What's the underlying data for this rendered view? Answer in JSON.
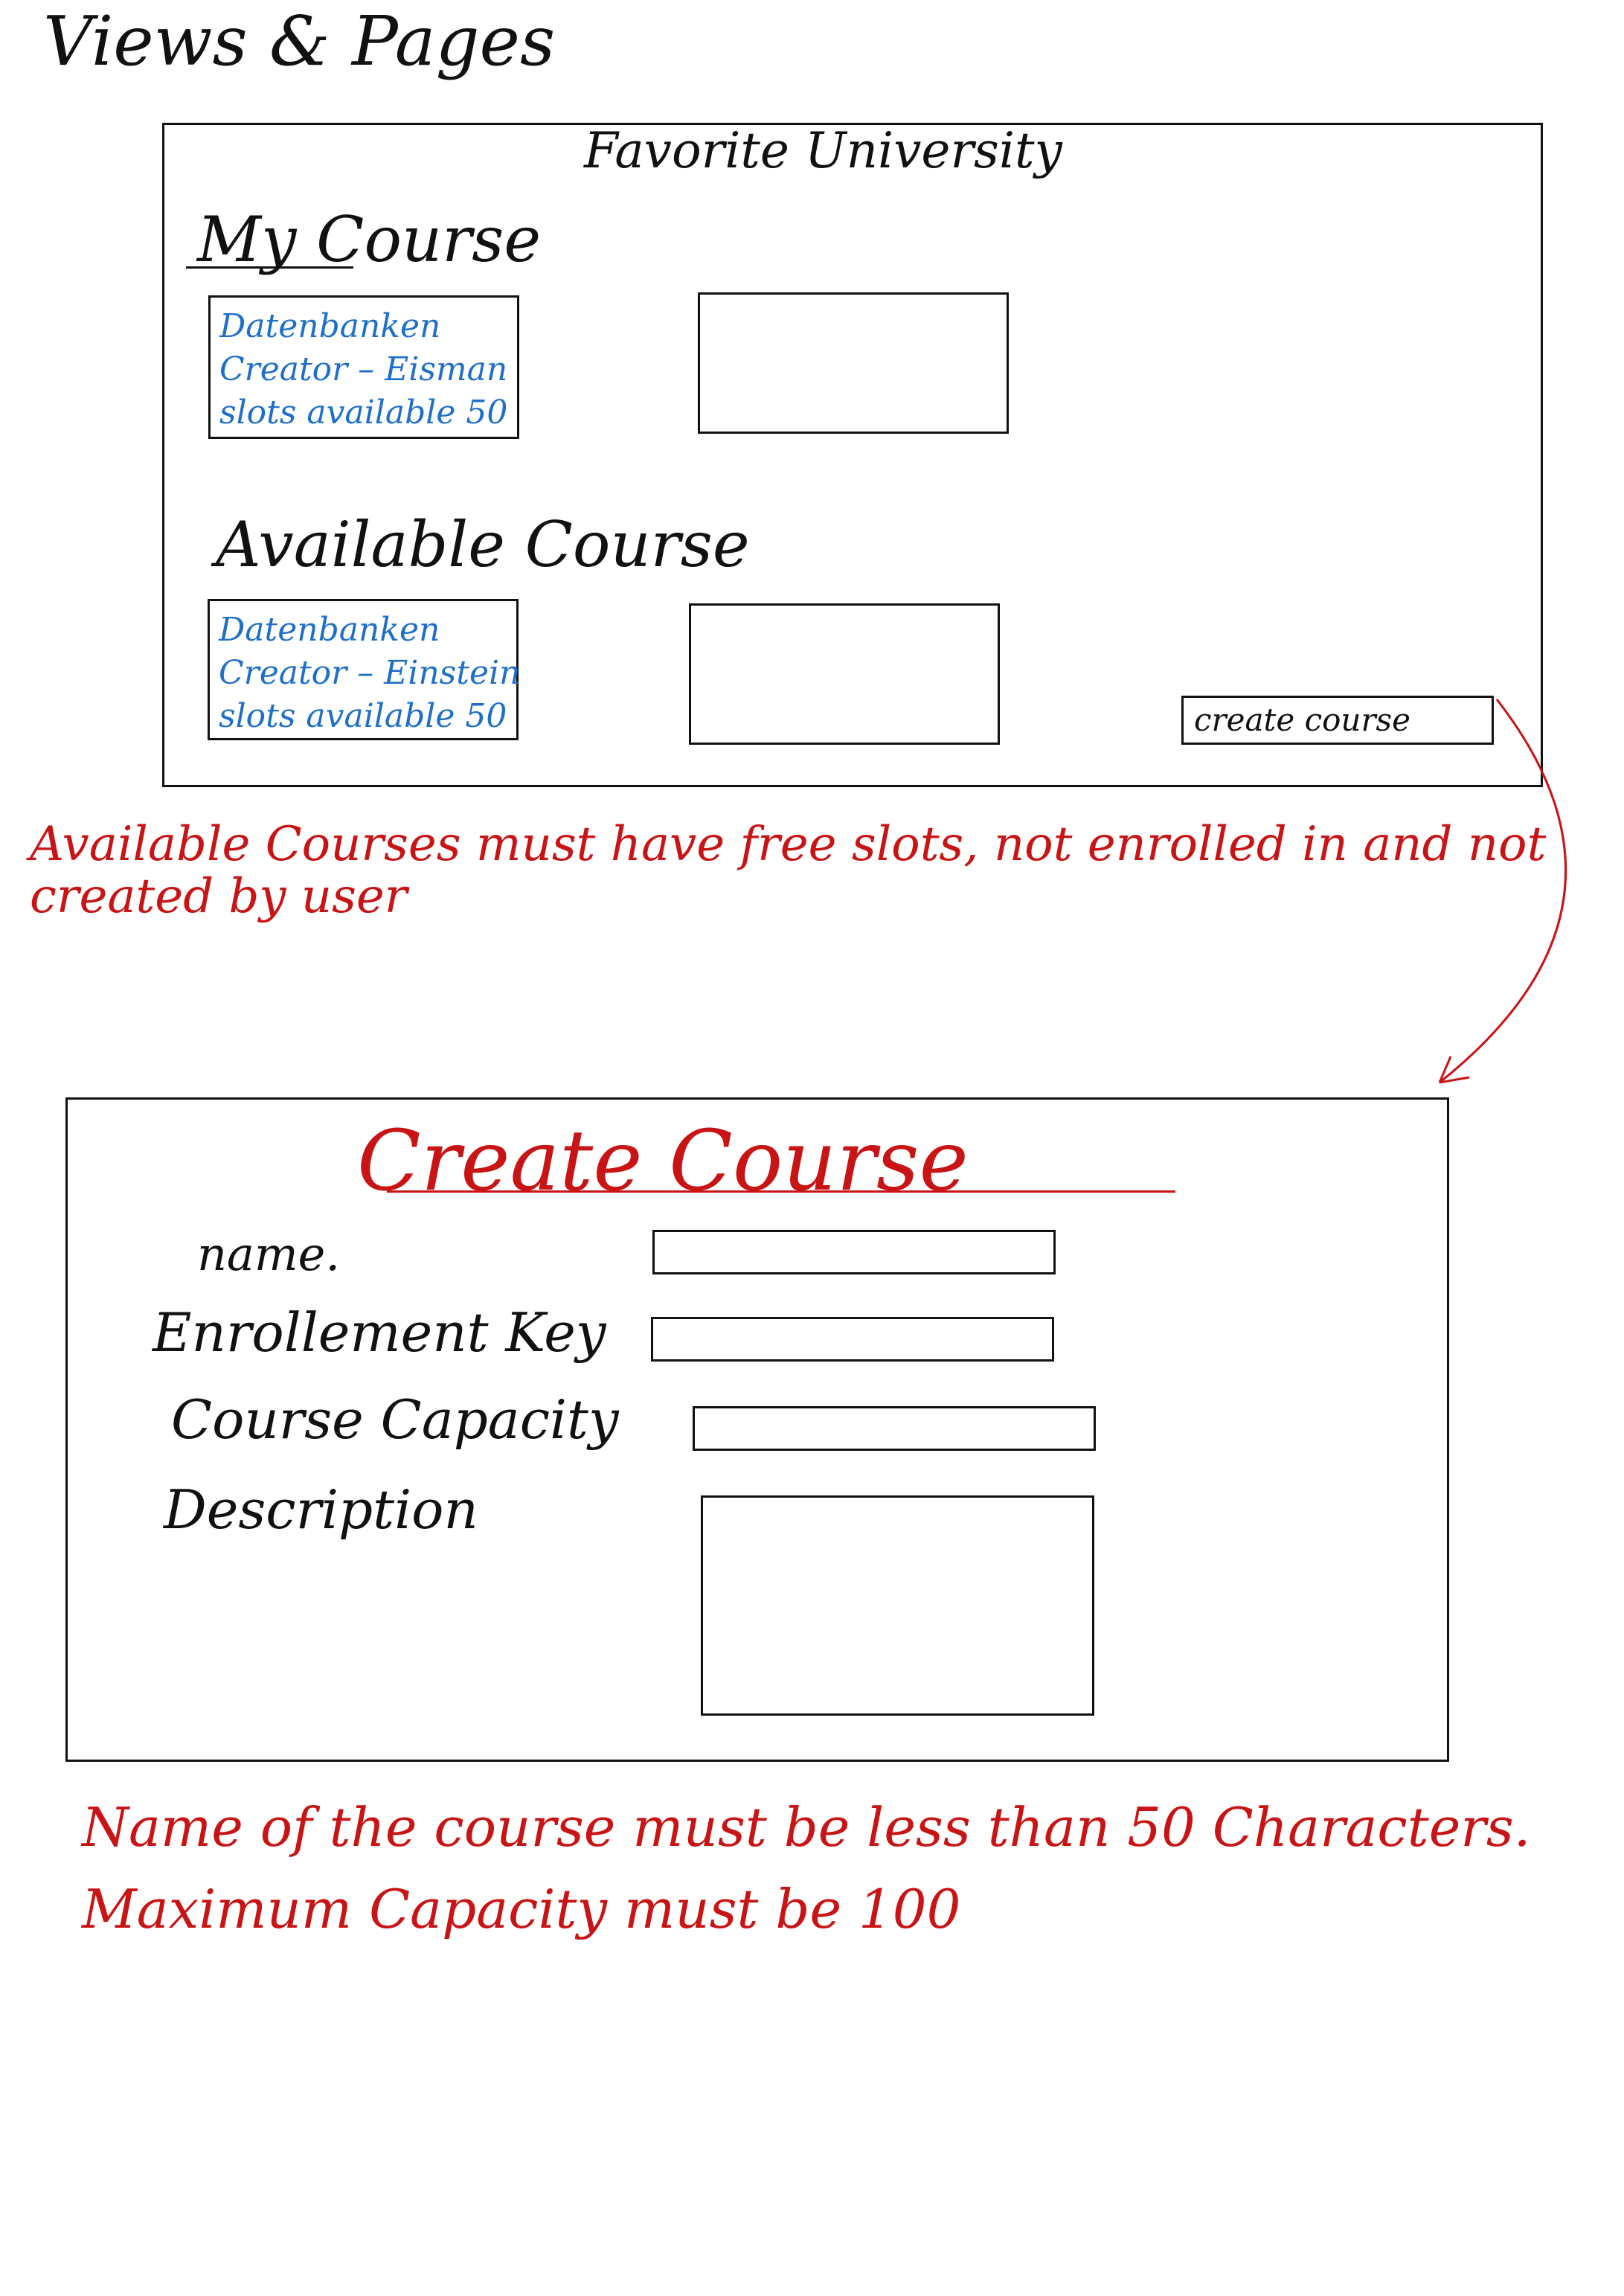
{
  "page": {
    "title": "Views & Pages"
  },
  "main_view": {
    "university": "Favorite University",
    "my_course": {
      "heading": "My Course",
      "card": {
        "name": "Datenbanken",
        "creator": "Creator – Eisman",
        "slots": "slots available 50"
      }
    },
    "available_course": {
      "heading": "Available Course",
      "card": {
        "name": "Datenbanken",
        "creator": "Creator – Einstein",
        "slots": "slots available 50"
      }
    },
    "create_course_button": "create course"
  },
  "notes": {
    "available_rule": "Available Courses must have free slots, not enrolled in and not created by user",
    "name_rule": "Name of the course must be less than 50 Characters.",
    "capacity_rule": "Maximum Capacity must be 100"
  },
  "create_view": {
    "title": "Create Course",
    "fields": {
      "name": "name.",
      "enrollment_key": "Enrollement Key",
      "capacity": "Course Capacity",
      "description": "Description"
    }
  },
  "colors": {
    "ink": "#111111",
    "blue": "#1f6fc9",
    "red": "#c81414"
  }
}
